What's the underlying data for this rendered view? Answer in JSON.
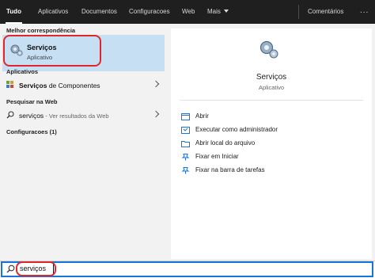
{
  "tabs": [
    {
      "label": "Tudo",
      "active": true
    },
    {
      "label": "Aplicativos"
    },
    {
      "label": "Documentos"
    },
    {
      "label": "Configuracoes"
    },
    {
      "label": "Web"
    },
    {
      "label": "Mais"
    }
  ],
  "comments_label": "Comentários",
  "more_options_label": "...",
  "left": {
    "best_match_heading": "Melhor correspondência",
    "best_match": {
      "title": "Serviços",
      "subtitle": "Aplicativo"
    },
    "apps_heading": "Aplicativos",
    "apps": [
      {
        "bold": "Serviços",
        "rest": " de Componentes"
      }
    ],
    "web_heading": "Pesquisar na Web",
    "web": {
      "query": "serviços",
      "suffix": " - Ver resultados da Web"
    },
    "settings_heading": "Configuracoes (1)"
  },
  "preview": {
    "title": "Serviços",
    "subtitle": "Aplicativo",
    "actions": [
      {
        "label": "Abrir",
        "icon": "open-icon"
      },
      {
        "label": "Executar como administrador",
        "icon": "run-as-admin-icon"
      },
      {
        "label": "Abrir local do arquivo",
        "icon": "file-location-icon"
      },
      {
        "label": "Fixar em Iniciar",
        "icon": "pin-start-icon"
      },
      {
        "label": "Fixar na barra de tarefas",
        "icon": "pin-taskbar-icon"
      }
    ]
  },
  "search": {
    "value": "serviços"
  },
  "colors": {
    "accent": "#1a73d6",
    "highlight": "#c7dff2",
    "annotation_red": "#e0262d",
    "topbar": "#1f1f1f"
  }
}
